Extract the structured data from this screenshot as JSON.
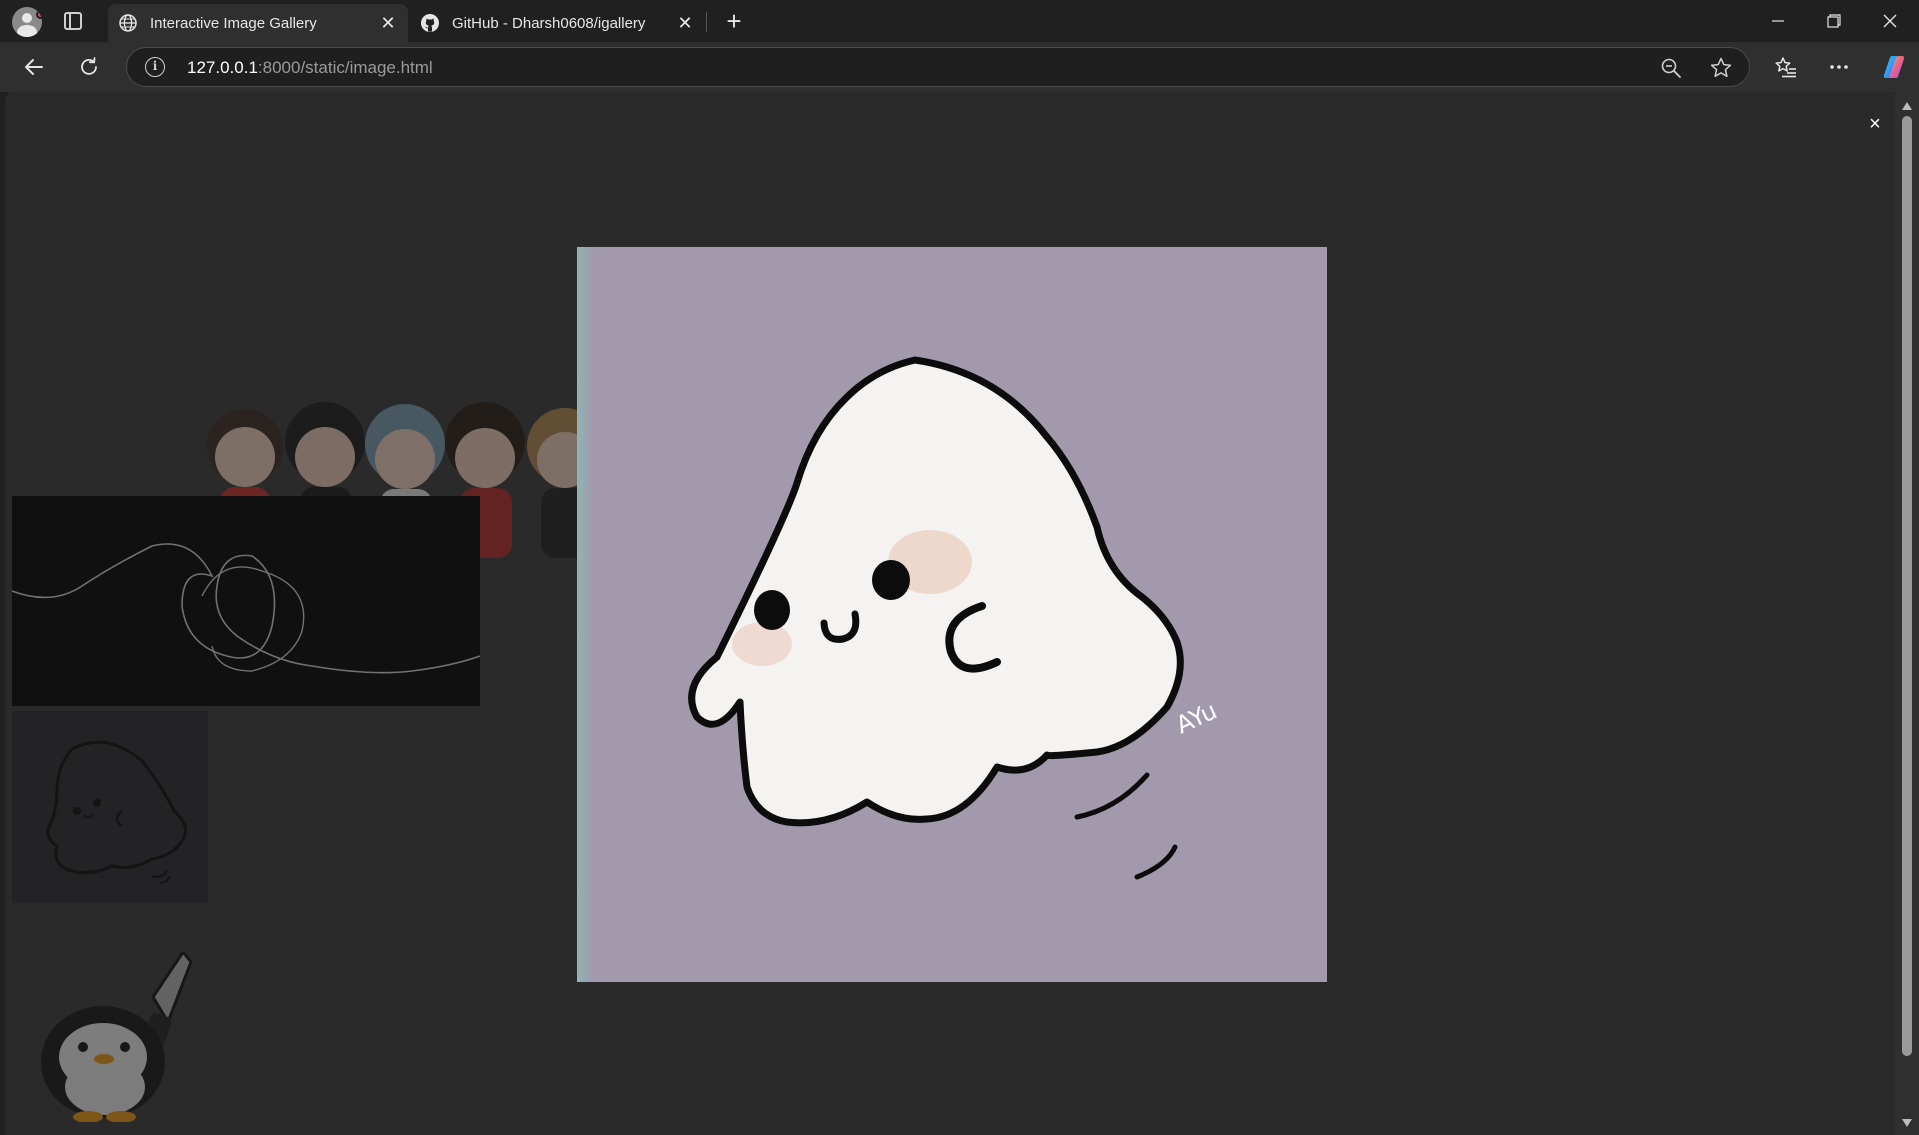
{
  "browser": {
    "tabs": [
      {
        "title": "Interactive Image Gallery",
        "favicon": "globe-icon",
        "active": true
      },
      {
        "title": "GitHub - Dharsh0608/igallery",
        "favicon": "github-icon",
        "active": false
      }
    ],
    "address": {
      "host": "127.0.0.1",
      "rest": ":8000/static/image.html"
    }
  },
  "lightbox": {
    "close_glyph": "×",
    "image_alt": "ghost illustration",
    "signature": "AYu"
  },
  "gallery": {
    "thumbnails": [
      "chibi-figures-image",
      "heart-line-art-image",
      "ghost-thumbnail-image",
      "penguin-knife-image"
    ]
  },
  "colors": {
    "page_bg": "#3a3a3a",
    "lightbox_bg": "#a29aac",
    "ghost_fill": "#f4f3f1",
    "blush": "#ecd2c6"
  }
}
